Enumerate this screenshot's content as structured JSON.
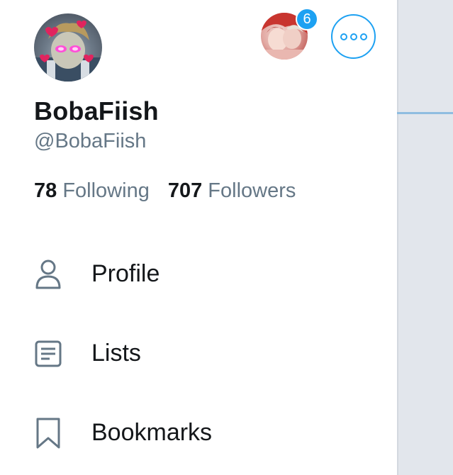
{
  "profile": {
    "display_name": "BobaFiish",
    "handle": "@BobaFiish",
    "following_count": "78",
    "following_label": "Following",
    "followers_count": "707",
    "followers_label": "Followers"
  },
  "account_switcher": {
    "badge_count": "6",
    "more_icon": "more-horizontal-icon"
  },
  "menu": [
    {
      "label": "Profile",
      "icon": "person-icon"
    },
    {
      "label": "Lists",
      "icon": "lists-icon"
    },
    {
      "label": "Bookmarks",
      "icon": "bookmark-icon"
    }
  ],
  "colors": {
    "accent": "#1da1f2",
    "text_primary": "#14171a",
    "text_secondary": "#657786",
    "backdrop": "#e2e6ec"
  }
}
